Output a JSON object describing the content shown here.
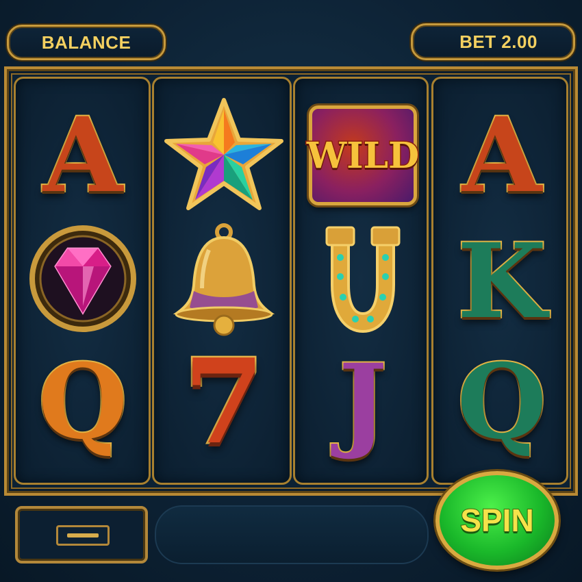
{
  "header": {
    "balance_label": "BALANCE",
    "bet_label": "BET 2.00"
  },
  "reels": [
    {
      "symbols": [
        {
          "type": "letter",
          "text": "A",
          "color": "#c7451b",
          "icon": "letter-a-icon"
        },
        {
          "type": "gem",
          "icon": "pink-gem-icon"
        },
        {
          "type": "letter",
          "text": "Q",
          "color": "#e07a1d",
          "icon": "letter-q-icon"
        }
      ]
    },
    {
      "symbols": [
        {
          "type": "star",
          "icon": "star-icon"
        },
        {
          "type": "bell",
          "icon": "bell-icon"
        },
        {
          "type": "seven",
          "text": "7",
          "icon": "seven-icon"
        }
      ]
    },
    {
      "symbols": [
        {
          "type": "wild",
          "text": "WILD",
          "icon": "wild-icon"
        },
        {
          "type": "horseshoe",
          "icon": "horseshoe-icon"
        },
        {
          "type": "letter",
          "text": "J",
          "color": "#9b3fa0",
          "icon": "letter-j-icon"
        }
      ]
    },
    {
      "symbols": [
        {
          "type": "letter",
          "text": "A",
          "color": "#c7451b",
          "icon": "letter-a-icon"
        },
        {
          "type": "letter",
          "text": "K",
          "color": "#1d7c5a",
          "icon": "letter-k-icon"
        },
        {
          "type": "letter",
          "text": "Q",
          "color": "#1d7c5a",
          "icon": "letter-q-icon"
        }
      ]
    }
  ],
  "controls": {
    "spin_label": "SPIN",
    "minus_icon": "minus-icon"
  },
  "colors": {
    "gold": "#c79a3c",
    "background": "#0d2235",
    "spin_green": "#1ab82a"
  }
}
